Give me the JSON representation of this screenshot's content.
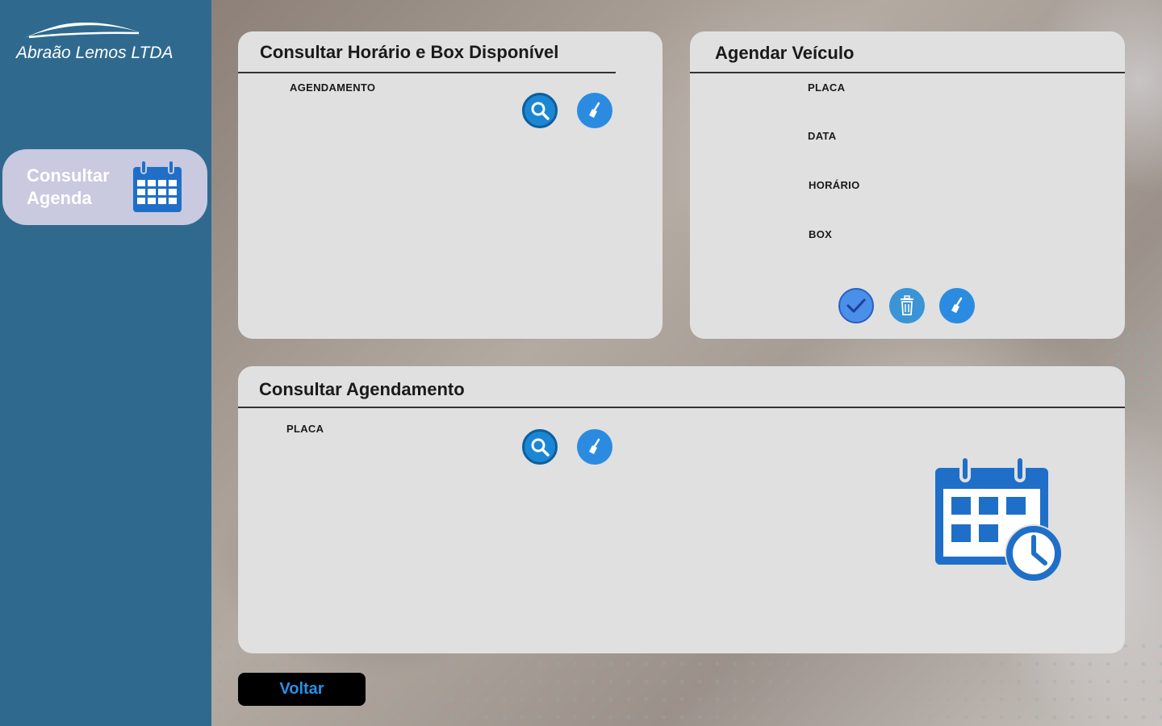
{
  "brand": {
    "name": "Abraão Lemos LTDA"
  },
  "sidebar": {
    "items": [
      {
        "label": "Consultar\nAgenda",
        "icon": "calendar-icon"
      }
    ]
  },
  "card_horario": {
    "title": "Consultar Horário e Box Disponível",
    "fields": {
      "agendamento": "AGENDAMENTO"
    },
    "buttons": {
      "search_icon": "search-icon",
      "clear_icon": "broom-icon"
    }
  },
  "card_agendar": {
    "title": "Agendar Veículo",
    "fields": {
      "placa": "PLACA",
      "data": "DATA",
      "horario": "HORÁRIO",
      "box": "BOX"
    },
    "buttons": {
      "confirm_icon": "check-icon",
      "delete_icon": "trash-icon",
      "clear_icon": "broom-icon"
    }
  },
  "card_consultar": {
    "title": "Consultar Agendamento",
    "fields": {
      "placa": "PLACA"
    },
    "buttons": {
      "search_icon": "search-icon",
      "clear_icon": "broom-icon"
    },
    "illustration": "calendar-clock-icon"
  },
  "footer": {
    "back_label": "Voltar"
  },
  "colors": {
    "sidebar": "#2f6a8e",
    "nav_active": "#c9c9e0",
    "card": "#e0e0e0",
    "accent_blue": "#1f6fc9",
    "button_text": "#2a8fe6"
  }
}
